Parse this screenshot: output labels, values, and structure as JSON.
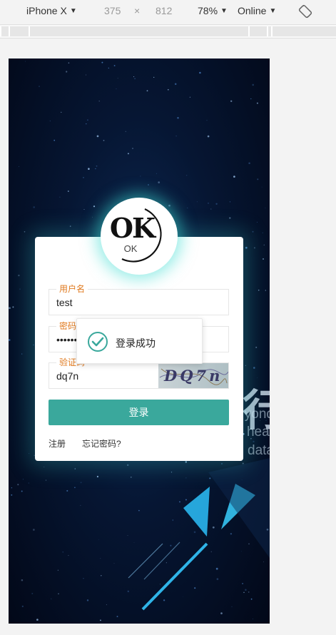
{
  "devtools": {
    "device": "iPhone X",
    "width": "375",
    "times": "×",
    "height": "812",
    "zoom": "78%",
    "network": "Online",
    "caret": "▼"
  },
  "logo": {
    "big": "OK",
    "small": "OK"
  },
  "form": {
    "username": {
      "label": "用户名",
      "value": "test"
    },
    "password": {
      "label": "密码",
      "value": "••••••"
    },
    "captcha": {
      "label": "验证码",
      "value": "dq7n",
      "image_text": "DQ7n"
    }
  },
  "login_button": "登录",
  "links": {
    "register": "注册",
    "forgot": "忘记密码?"
  },
  "toast": {
    "message": "登录成功"
  },
  "background": {
    "line1": "yond",
    "line2": "hear",
    "line3": "data",
    "glyph": "行"
  },
  "colors": {
    "accent": "#3aa89c",
    "label": "#e07a1f",
    "glow": "#3cdcd2"
  }
}
